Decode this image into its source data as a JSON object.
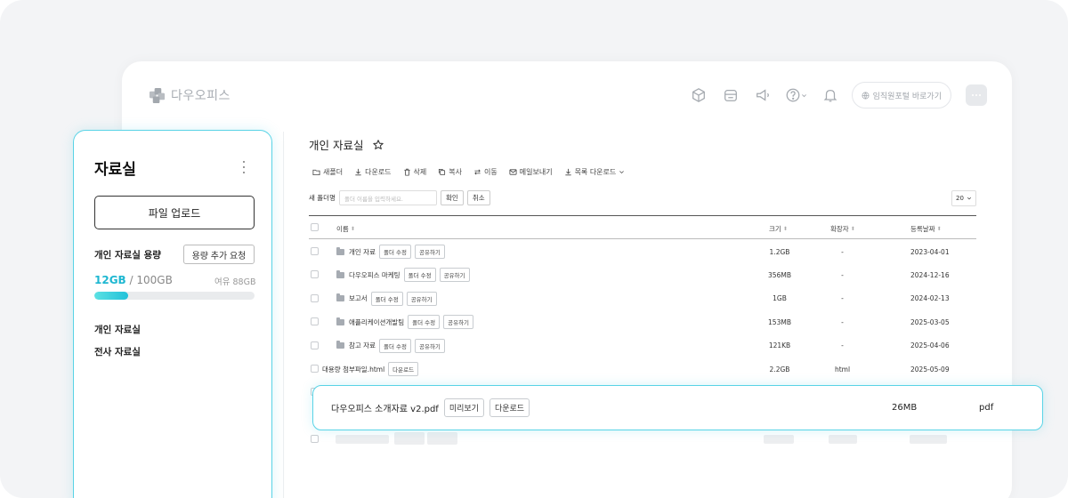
{
  "app": {
    "name": "다우오피스"
  },
  "header": {
    "portal_label": "임직원포털 바로가기"
  },
  "sidebar": {
    "title": "자료실",
    "upload_label": "파일 업로드",
    "capacity": {
      "label": "개인 자료실 용량",
      "request_label": "용량 추가 요청",
      "used": "12GB",
      "separator": " / ",
      "total": "100GB",
      "free": "여유 88GB",
      "used_fraction": 0.12
    },
    "nav": [
      "개인 자료실",
      "전사 자료실"
    ]
  },
  "main": {
    "title": "개인 자료실",
    "toolbar": [
      {
        "icon": "folder-outline-icon",
        "label": "새폴더"
      },
      {
        "icon": "download-icon",
        "label": "다운로드"
      },
      {
        "icon": "trash-icon",
        "label": "삭제"
      },
      {
        "icon": "copy-icon",
        "label": "복사"
      },
      {
        "icon": "move-icon",
        "label": "이동"
      },
      {
        "icon": "mail-icon",
        "label": "메일보내기"
      },
      {
        "icon": "download-icon",
        "label": "목록 다운로드"
      }
    ],
    "new_folder": {
      "label": "새 폴더명",
      "placeholder": "폴더 이름을 입력하세요.",
      "confirm": "확인",
      "cancel": "취소"
    },
    "page_size": "20",
    "columns": {
      "name": "이름",
      "size": "크기",
      "ext": "확장자",
      "date": "등록날짜"
    },
    "rows": [
      {
        "type": "folder",
        "name": "개인 자료",
        "actions": [
          "폴더 수정",
          "공유하기"
        ],
        "size": "1.2GB",
        "ext": "-",
        "date": "2023-04-01"
      },
      {
        "type": "folder",
        "name": "다우오피스 마케팅",
        "actions": [
          "폴더 수정",
          "공유하기"
        ],
        "size": "356MB",
        "ext": "-",
        "date": "2024-12-16"
      },
      {
        "type": "folder",
        "name": "보고서",
        "actions": [
          "폴더 수정",
          "공유하기"
        ],
        "size": "1GB",
        "ext": "-",
        "date": "2024-02-13"
      },
      {
        "type": "folder",
        "name": "애플리케이션개발팀",
        "actions": [
          "폴더 수정",
          "공유하기"
        ],
        "size": "153MB",
        "ext": "-",
        "date": "2025-03-05"
      },
      {
        "type": "folder",
        "name": "참고 자료",
        "actions": [
          "폴더 수정",
          "공유하기"
        ],
        "size": "121KB",
        "ext": "-",
        "date": "2025-04-06"
      },
      {
        "type": "file",
        "name": "대용량 첨부파일.html",
        "actions": [
          "다운로드"
        ],
        "size": "2.2GB",
        "ext": "html",
        "date": "2025-05-09"
      }
    ],
    "highlight_row": {
      "name": "다우오피스 소개자료 v2.pdf",
      "actions": [
        "미리보기",
        "다운로드"
      ],
      "size": "26MB",
      "ext": "pdf"
    }
  },
  "colors": {
    "accent": "#21c1d9",
    "accent_border": "#59d3e6",
    "muted": "#a8adb3"
  }
}
